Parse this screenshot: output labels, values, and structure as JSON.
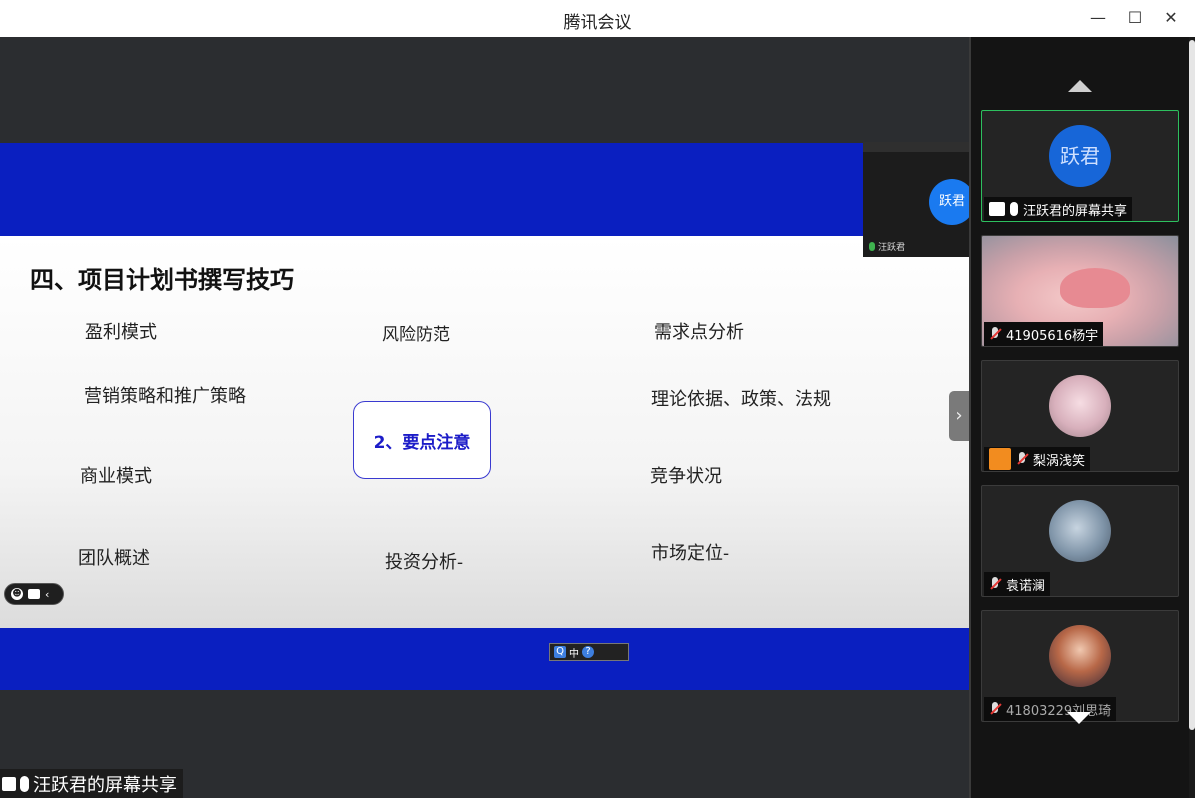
{
  "window": {
    "title": "腾讯会议",
    "min_icon": "—",
    "max_icon": "☐",
    "close_icon": "✕"
  },
  "slide": {
    "title": "四、项目计划书撰写技巧",
    "center": "2、要点注意",
    "items": [
      "盈利模式",
      "风险防范",
      "需求点分析",
      "营销策略和推广策略",
      "理论依据、政策、法规",
      "商业模式",
      "竞争状况",
      "团队概述",
      "投资分析-",
      "市场定位-"
    ]
  },
  "mini_tile": {
    "avatar_text": "跃君",
    "name": "汪跃君"
  },
  "share_label": "汪跃君的屏幕共享",
  "ime": {
    "q": "Q",
    "mode": "中",
    "help": "?"
  },
  "participants": [
    {
      "avatar_text": "跃君",
      "name": "汪跃君的屏幕共享"
    },
    {
      "name": "41905616杨宇"
    },
    {
      "name": "梨涡浅笑"
    },
    {
      "name": "袁诺澜"
    },
    {
      "name": "41803229刘思琦"
    }
  ],
  "colors": {
    "slide_blue": "#0a1fc0",
    "accent_blue": "#1766d8",
    "active_green": "#2dbf5e"
  }
}
